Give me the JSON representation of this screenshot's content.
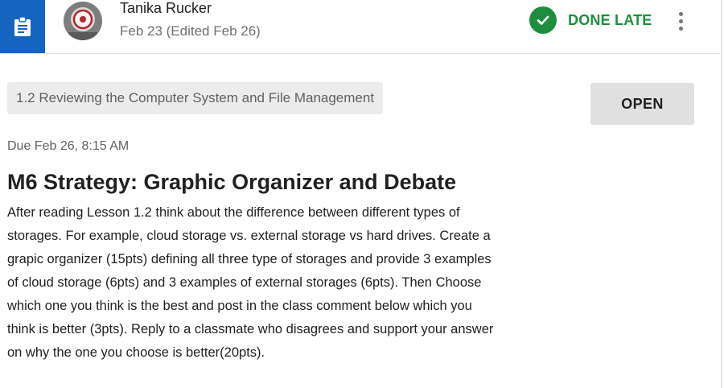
{
  "header": {
    "author": "Tanika Rucker",
    "date": "Feb 23 (Edited Feb 26)",
    "status": "DONE LATE",
    "type_icon": "assignment-icon",
    "status_icon": "check-circle-icon",
    "more_icon": "more-vert-icon",
    "accent_color": "#1565c0",
    "status_color": "#1e8e3e"
  },
  "assignment": {
    "topic": "1.2 Reviewing the Computer System and File Management",
    "open_label": "OPEN",
    "due": "Due Feb 26, 8:15 AM",
    "title": "M6 Strategy: Graphic Organizer and Debate",
    "description_lines": [
      "After reading Lesson 1.2 think about the difference between different types of",
      "storages. For example, cloud storage vs. external storage vs hard drives. Create a",
      "grapic organizer (15pts) defining all three type of storages and provide 3 examples",
      "of cloud storage (6pts) and 3 examples of external storages (6pts). Then Choose",
      "which one you think is the best and post in the class comment below which you",
      "think is better (3pts). Reply to a classmate who disagrees and support your answer",
      "on why the one you choose is better(20pts)."
    ]
  }
}
